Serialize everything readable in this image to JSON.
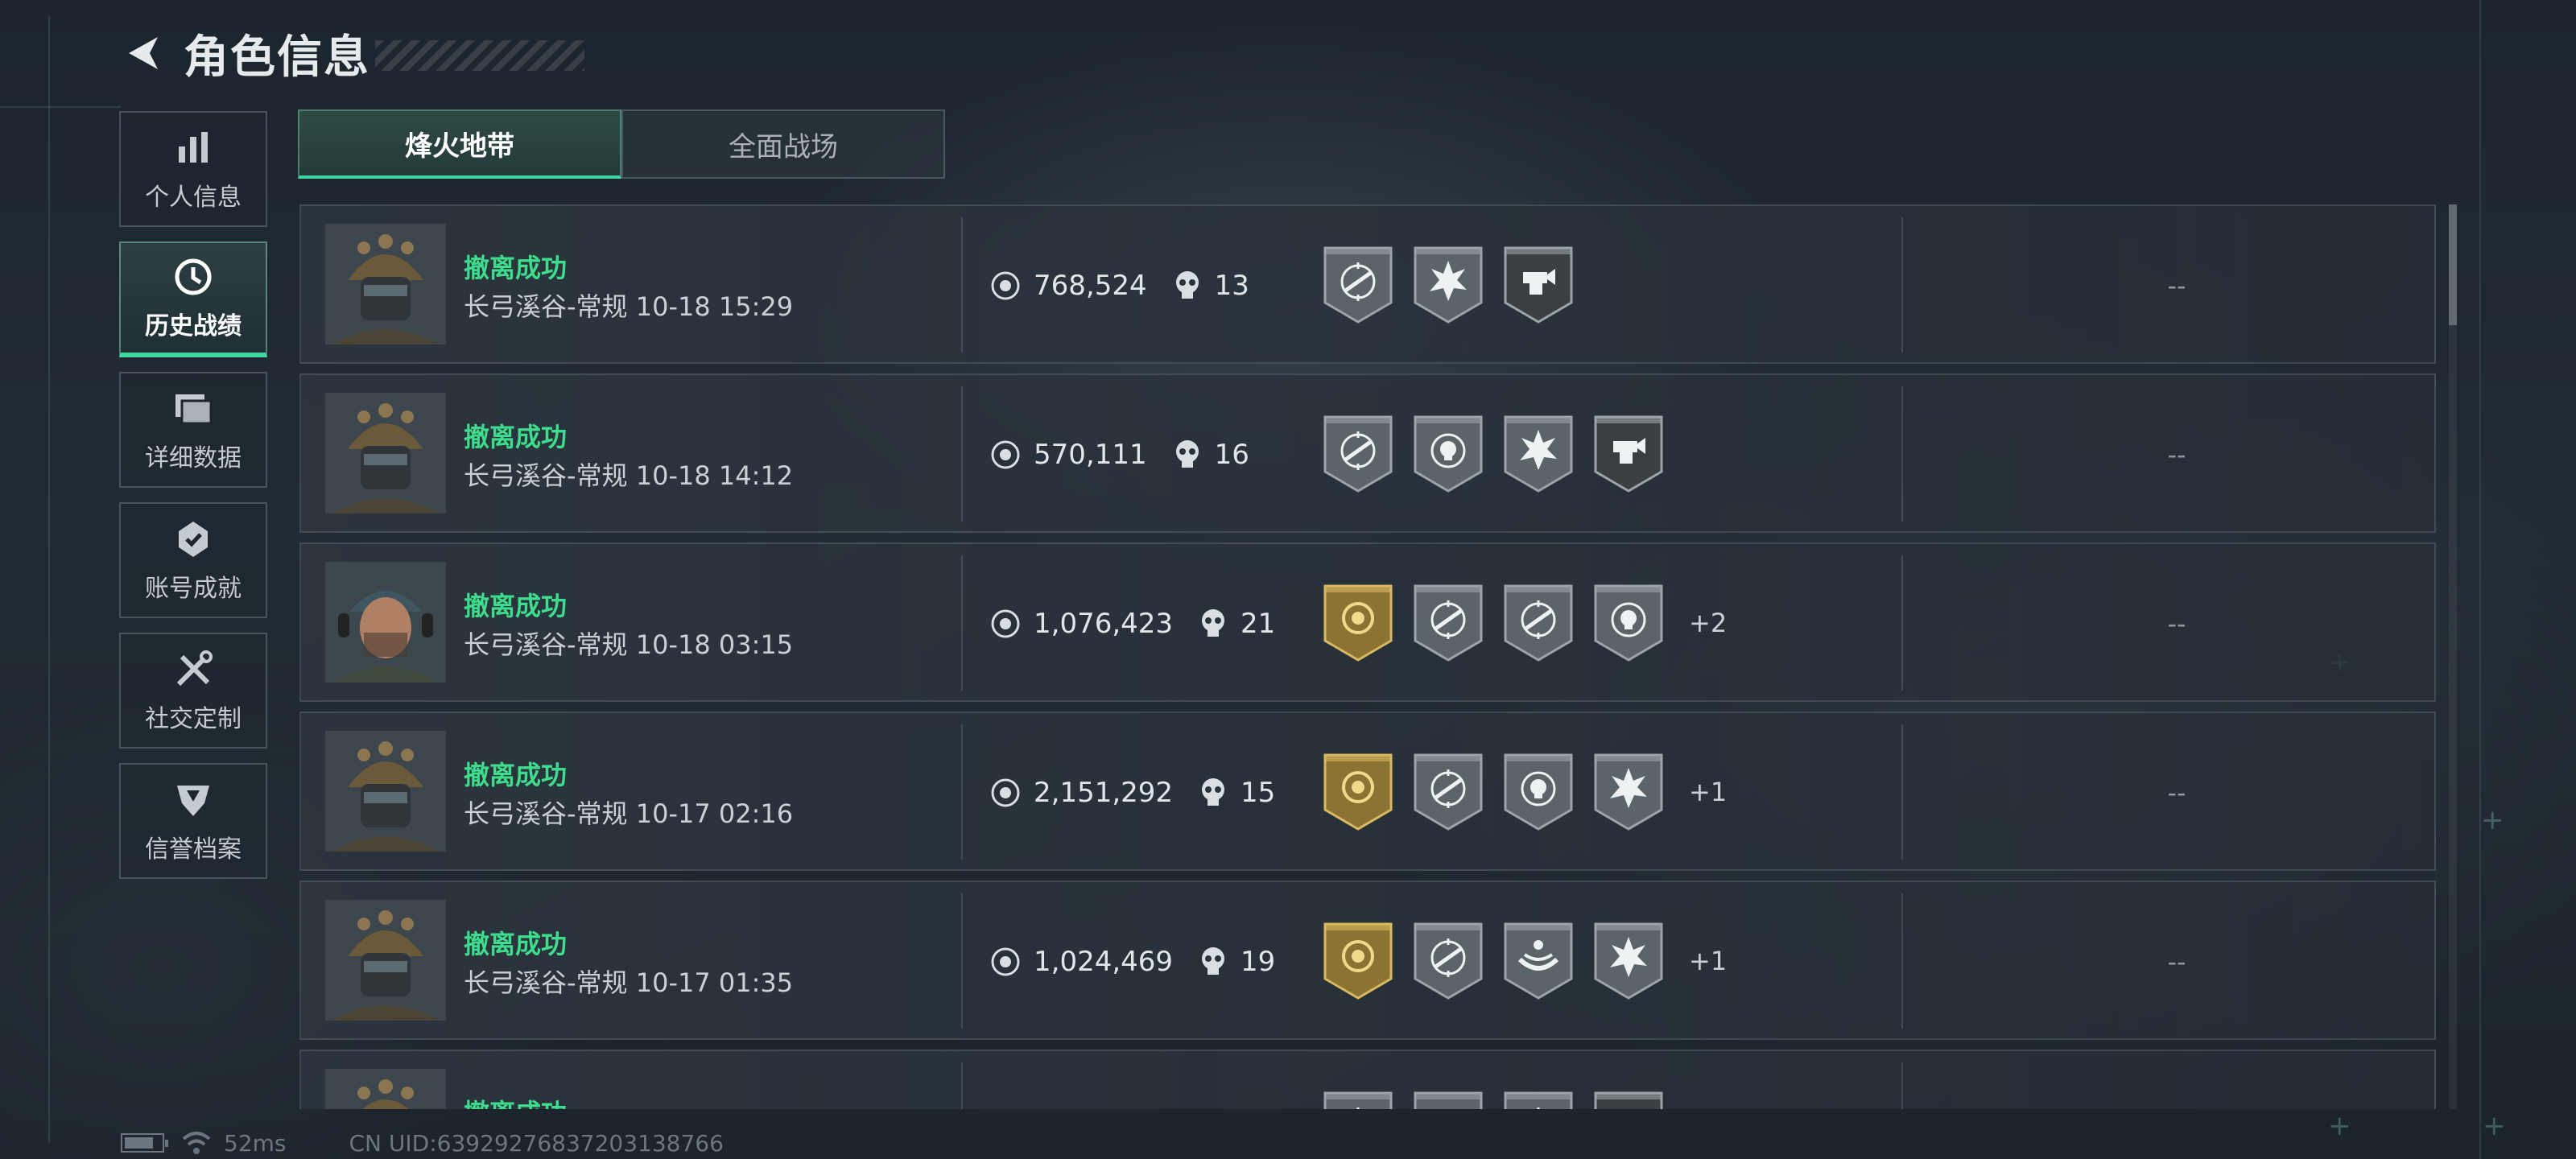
{
  "header": {
    "title": "角色信息"
  },
  "sidebar": {
    "items": [
      {
        "label": "个人信息",
        "icon": "bar-chart-icon",
        "active": false
      },
      {
        "label": "历史战绩",
        "icon": "history-clock-icon",
        "active": true
      },
      {
        "label": "详细数据",
        "icon": "folder-icon",
        "active": false
      },
      {
        "label": "账号成就",
        "icon": "achievement-icon",
        "active": false
      },
      {
        "label": "社交定制",
        "icon": "tools-icon",
        "active": false
      },
      {
        "label": "信誉档案",
        "icon": "reputation-shield-icon",
        "active": false
      }
    ]
  },
  "tabs": [
    {
      "label": "烽火地带",
      "active": true
    },
    {
      "label": "全面战场",
      "active": false
    }
  ],
  "records": [
    {
      "status": "撤离成功",
      "detail": "长弓溪谷-常规 10-18 15:29",
      "value": "768,524",
      "kills": "13",
      "badges": [
        "rifle-target-badge",
        "explosion-badge",
        "weapon-hand-badge"
      ],
      "extra": "",
      "right": "--",
      "avatar": "helmet-soldier"
    },
    {
      "status": "撤离成功",
      "detail": "长弓溪谷-常规 10-18 14:12",
      "value": "570,111",
      "kills": "16",
      "badges": [
        "rifle-target-badge",
        "skull-target-badge",
        "explosion-badge",
        "weapon-hand-badge"
      ],
      "extra": "",
      "right": "--",
      "avatar": "helmet-soldier"
    },
    {
      "status": "撤离成功",
      "detail": "长弓溪谷-常规 10-18 03:15",
      "value": "1,076,423",
      "kills": "21",
      "badges": [
        "gold-coin-badge",
        "rifle-target-badge",
        "rifle-target-badge",
        "skull-target-badge"
      ],
      "extra": "+2",
      "right": "--",
      "avatar": "cap-operator"
    },
    {
      "status": "撤离成功",
      "detail": "长弓溪谷-常规 10-17 02:16",
      "value": "2,151,292",
      "kills": "15",
      "badges": [
        "gold-coin-badge",
        "rifle-target-badge",
        "skull-target-badge",
        "explosion-badge"
      ],
      "extra": "+1",
      "right": "--",
      "avatar": "helmet-soldier"
    },
    {
      "status": "撤离成功",
      "detail": "长弓溪谷-常规 10-17 01:35",
      "value": "1,024,469",
      "kills": "19",
      "badges": [
        "gold-coin-badge",
        "rifle-target-badge",
        "hands-badge",
        "explosion-badge"
      ],
      "extra": "+1",
      "right": "--",
      "avatar": "helmet-soldier"
    },
    {
      "status": "撤离成功",
      "detail": "",
      "value": "",
      "kills": "",
      "badges": [
        "rifle-target-badge",
        "skull-target-badge",
        "rifle-target-badge",
        "weapon-hand-badge"
      ],
      "extra": "",
      "right": "",
      "avatar": "helmet-soldier"
    }
  ],
  "footer": {
    "ping": "52ms",
    "uid": "CN UID:6392927683720313876​6",
    "battery_level": 0.8
  },
  "colors": {
    "accent": "#3fd6a0",
    "success": "#3fdc8e",
    "gold": "#c9a24a"
  }
}
